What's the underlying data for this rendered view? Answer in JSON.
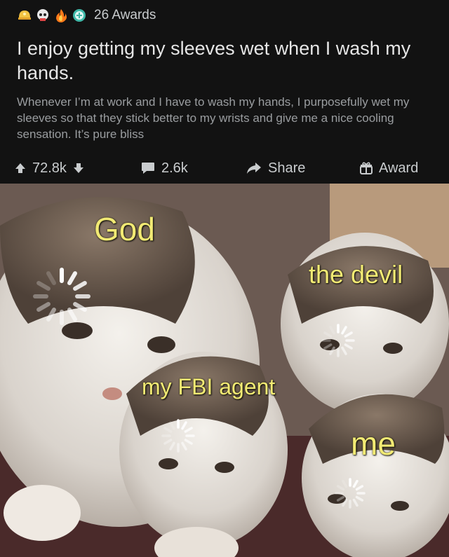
{
  "post": {
    "awards": {
      "count_label": "26 Awards",
      "icons": [
        "helmet-award-icon",
        "skull-award-icon",
        "fire-award-icon",
        "shield-award-icon"
      ]
    },
    "title": "I enjoy getting my sleeves wet when I wash my hands.",
    "body": "Whenever I’m at work and I have to wash my hands, I purposefully wet my sleeves so that they stick better to my wrists and give me a nice cooling sensation. It’s pure bliss",
    "actions": {
      "upvotes": "72.8k",
      "comments": "2.6k",
      "share": "Share",
      "award": "Award"
    }
  },
  "meme": {
    "captions": {
      "god": "God",
      "devil": "the devil",
      "fbi": "my FBI agent",
      "me": "me"
    }
  },
  "colors": {
    "background": "#121212",
    "caption": "#f2ea74",
    "text": "#d7dadc",
    "muted": "#9a9da0"
  }
}
